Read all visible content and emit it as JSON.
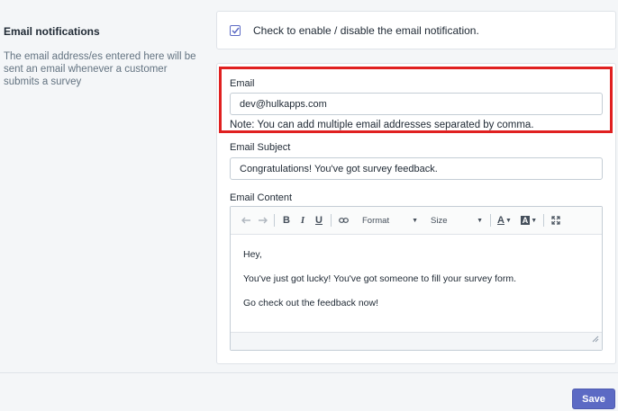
{
  "section": {
    "title": "Email notifications",
    "description": "The email address/es entered here will be sent an email whenever a customer submits a survey"
  },
  "toggle": {
    "label": "Check to enable / disable the email notification.",
    "checked": true
  },
  "email": {
    "label": "Email",
    "value": "dev@hulkapps.com",
    "note": "Note: You can add multiple email addresses separated by comma."
  },
  "subject": {
    "label": "Email Subject",
    "value": "Congratulations! You've got survey feedback."
  },
  "content": {
    "label": "Email Content",
    "toolbar": {
      "format_label": "Format",
      "size_label": "Size"
    },
    "lines": [
      "Hey,",
      "You've just got lucky! You've got someone to fill your survey form.",
      "Go check out the feedback now!"
    ]
  },
  "save_label": "Save",
  "colors": {
    "accent": "#5c6ac4",
    "highlight": "#e02020"
  }
}
